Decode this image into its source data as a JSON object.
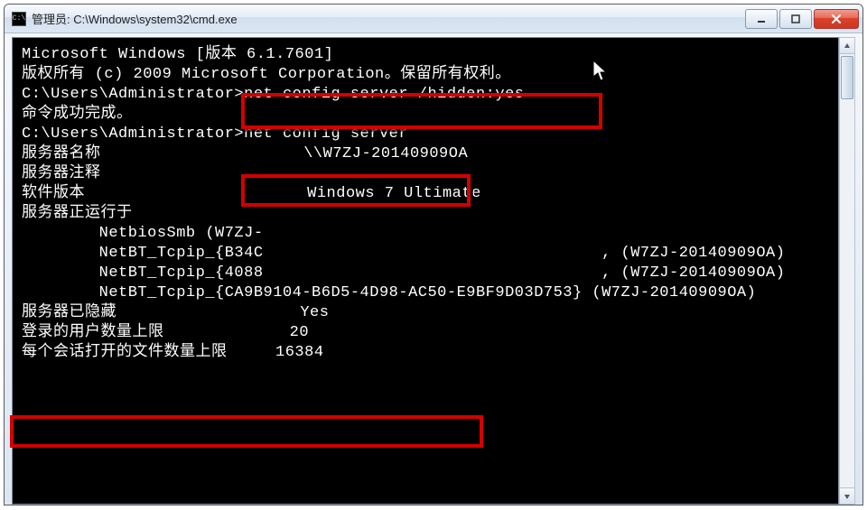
{
  "window": {
    "iconText": "C:\\",
    "title": "管理员: C:\\Windows\\system32\\cmd.exe"
  },
  "lines": {
    "l0": "Microsoft Windows [版本 6.1.7601]",
    "l1": "版权所有 (c) 2009 Microsoft Corporation。保留所有权利。",
    "l2": "",
    "l3": "C:\\Users\\Administrator>net config server /hidden:yes",
    "l4": "命令成功完成。",
    "l5": "",
    "l6": "",
    "l7": "C:\\Users\\Administrator>net config server",
    "l8": "服务器名称                     \\\\W7ZJ-20140909OA",
    "l9": "服务器注释",
    "l10": "",
    "l11": "软件版本                       Windows 7 Ultimate",
    "l12": "服务器正运行于",
    "l13": "        NetbiosSmb (W7ZJ-",
    "l14": "        NetBT_Tcpip_{B34C                                   , (W7ZJ-20140909OA)",
    "l15": "        NetBT_Tcpip_{4088                                   , (W7ZJ-20140909OA)",
    "l16": "        NetBT_Tcpip_{CA9B9104-B6D5-4D98-AC50-E9BF9D03D753} (W7ZJ-20140909OA)",
    "l17": "",
    "l18": "",
    "l19": "服务器已隐藏                   Yes",
    "l20": "登录的用户数量上限             20",
    "l21": "每个会话打开的文件数量上限     16384"
  }
}
